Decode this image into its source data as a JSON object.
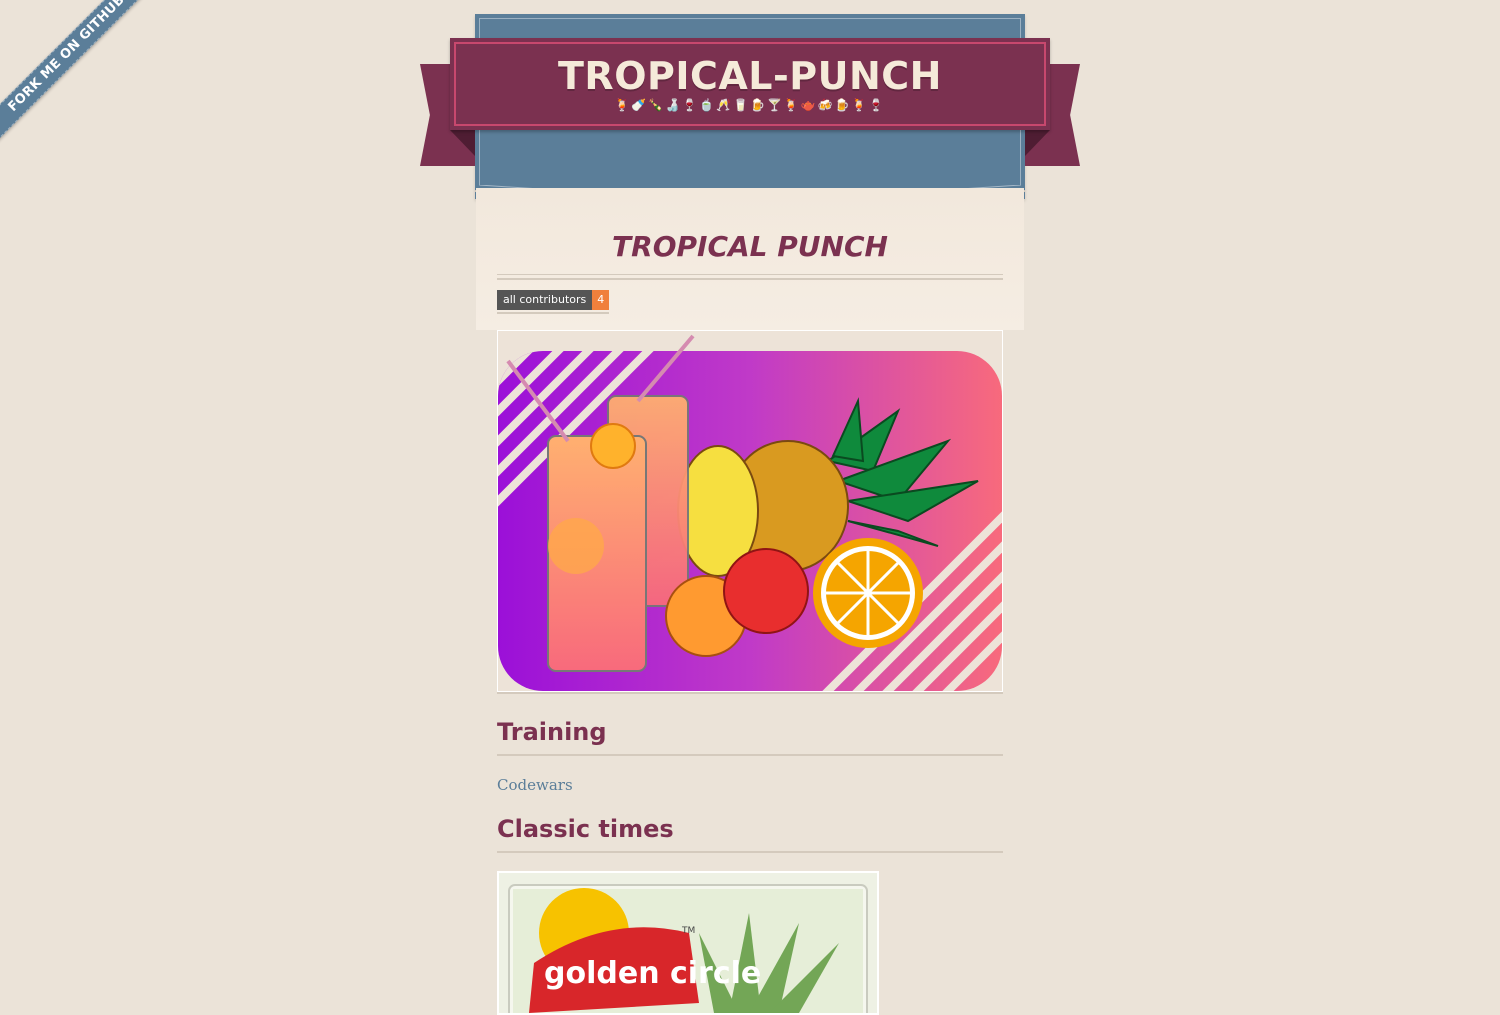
{
  "fork_ribbon": {
    "label": "Fork me on GitHub"
  },
  "header": {
    "title": "TROPICAL-PUNCH",
    "emojis": "🍹🍼🍾🍶🍷🍵🥂🥛🍺🍸🍹🫖🍻🍺🍹🍷"
  },
  "main": {
    "title": "TROPICAL PUNCH",
    "badge": {
      "label": "all contributors",
      "count": "4"
    },
    "sections": [
      {
        "heading": "Training",
        "link": "Codewars"
      },
      {
        "heading": "Classic times"
      }
    ],
    "package_text": {
      "brand": "golden circle",
      "tm": "TM"
    }
  },
  "colors": {
    "background": "#ebe3d8",
    "ribbon": "#7b3150",
    "banner_blue": "#5b7e99",
    "accent": "#c8486e",
    "badge_orange": "#f0803c"
  },
  "icons": {
    "hero_image": "tropical-punch-illustration",
    "photo": "golden-circle-package"
  }
}
